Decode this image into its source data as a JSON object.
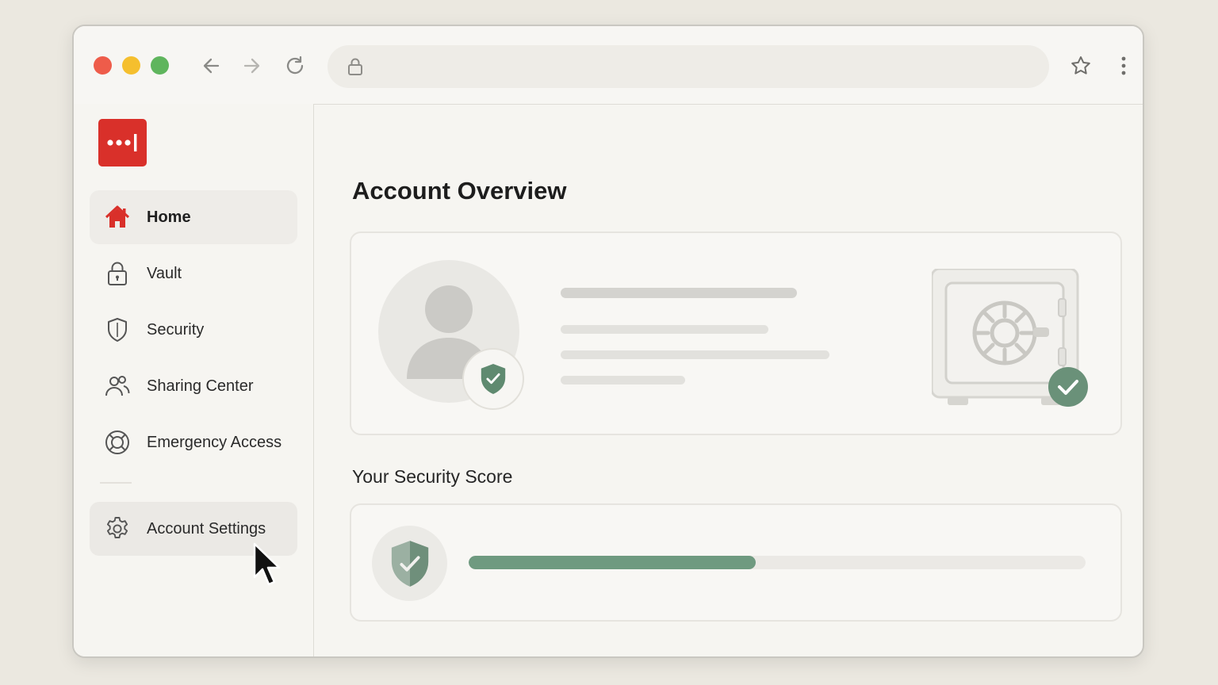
{
  "browser": {
    "address_url": "",
    "traffic_lights": [
      "close",
      "minimize",
      "maximize"
    ],
    "icons": [
      "back-arrow-icon",
      "forward-arrow-icon",
      "reload-icon",
      "lock-icon",
      "star-icon",
      "more-vertical-icon"
    ]
  },
  "brand": {
    "logo_glyph": "•••|",
    "logo_color": "#d9302a"
  },
  "sidebar": {
    "items": [
      {
        "label": "Home",
        "icon": "home-icon",
        "active": true
      },
      {
        "label": "Vault",
        "icon": "lock-icon"
      },
      {
        "label": "Security",
        "icon": "shield-icon"
      },
      {
        "label": "Sharing Center",
        "icon": "people-icon"
      },
      {
        "label": "Emergency Access",
        "icon": "lifebuoy-icon"
      }
    ],
    "settings": {
      "label": "Account Settings",
      "icon": "gear-icon",
      "hovered": true
    }
  },
  "main": {
    "title": "Account Overview",
    "profile_card": {
      "avatar_icon": "user-avatar-icon",
      "badge_icon": "shield-check-icon",
      "vault_icon": "safe-icon",
      "vault_badge_icon": "check-circle-icon"
    },
    "score_section": {
      "title": "Your Security Score",
      "progress_fraction": 0.465,
      "shield_icon": "shield-check-icon"
    }
  },
  "colors": {
    "accent_green": "#6f9a80",
    "brand_red": "#d9302a",
    "background": "#f6f5f1"
  }
}
